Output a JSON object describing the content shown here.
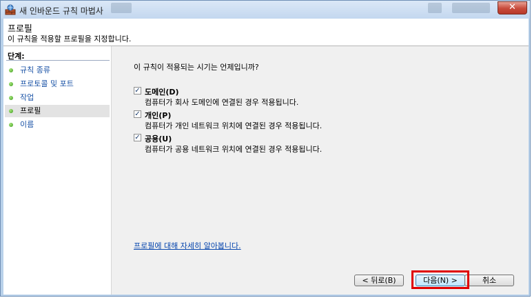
{
  "window": {
    "title": "새 인바운드 규칙 마법사",
    "close_glyph": "✕"
  },
  "header": {
    "title": "프로필",
    "subtitle": "이 규칙을 적용할 프로필을 지정합니다."
  },
  "steps": {
    "heading": "단계:",
    "items": [
      {
        "label": "규칙 종류"
      },
      {
        "label": "프로토콜 및 포트"
      },
      {
        "label": "작업"
      },
      {
        "label": "프로필"
      },
      {
        "label": "이름"
      }
    ],
    "active_index": 3
  },
  "main": {
    "question": "이 규칙이 적용되는 시기는 언제입니까?",
    "options": [
      {
        "label": "도메인(D)",
        "desc": "컴퓨터가 회사 도메인에 연결된 경우 적용됩니다.",
        "checked": true,
        "check_glyph": "✓"
      },
      {
        "label": "개인(P)",
        "desc": "컴퓨터가 개인 네트워크 위치에 연결된 경우 적용됩니다.",
        "checked": true,
        "check_glyph": "✓"
      },
      {
        "label": "공용(U)",
        "desc": "컴퓨터가 공용 네트워크 위치에 연결된 경우 적용됩니다.",
        "checked": true,
        "check_glyph": "✓"
      }
    ],
    "learn_more": "프로필에 대해 자세히 알아봅니다."
  },
  "buttons": {
    "back": "< 뒤로(B)",
    "next": "다음(N) >",
    "cancel": "취소"
  },
  "colors": {
    "highlight": "#e00000",
    "link": "#0645ad",
    "step_dot": "#3c9a1c"
  }
}
